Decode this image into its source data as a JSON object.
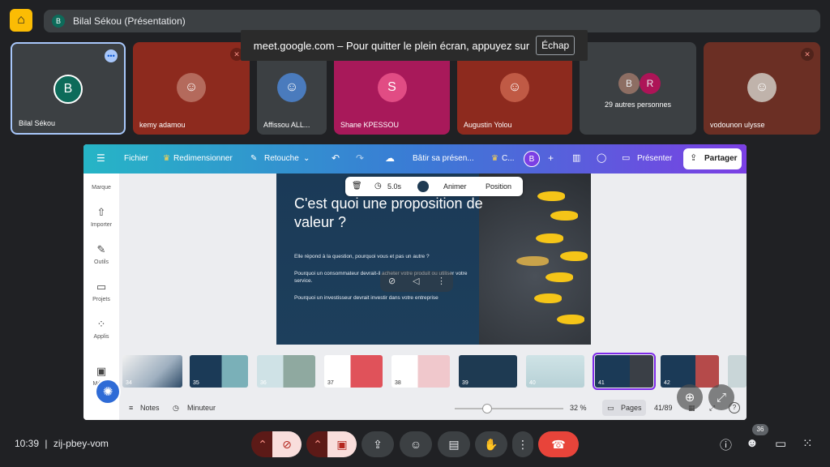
{
  "top_bar": {
    "presenter_initial": "B",
    "presenter_title": "Bilal Sékou (Présentation)"
  },
  "toast": {
    "message": "meet.google.com – Pour quitter le plein écran, appuyez sur",
    "key": "Échap"
  },
  "participants": [
    {
      "name": "Bilal Sékou",
      "initial": "B",
      "muted": false,
      "speaking": true
    },
    {
      "name": "kemy adamou",
      "initial": "",
      "muted": true
    },
    {
      "name": "Affissou ALL...",
      "initial": "",
      "muted": false
    },
    {
      "name": "Shane KPESSOU",
      "initial": "S",
      "muted": false
    },
    {
      "name": "Augustin Yolou",
      "initial": "",
      "muted": false
    },
    {
      "name": "29 autres personnes",
      "initials": [
        "B",
        "R"
      ]
    },
    {
      "name": "vodounon ulysse",
      "initial": "",
      "muted": true
    }
  ],
  "canva": {
    "menu": {
      "file": "Fichier",
      "resize": "Redimensionner",
      "edit": "Retouche",
      "doc_title": "Bâtir sa présen...",
      "crown_item": "C...",
      "user_initial": "B",
      "present": "Présenter",
      "share": "Partager"
    },
    "sidebar": [
      {
        "label": "Marque",
        "icon": "brand-icon"
      },
      {
        "label": "Importer",
        "icon": "upload-icon"
      },
      {
        "label": "Outils",
        "icon": "pen-icon"
      },
      {
        "label": "Projets",
        "icon": "folder-icon"
      },
      {
        "label": "Applis",
        "icon": "apps-icon"
      },
      {
        "label": "Médi...",
        "icon": "media-icon"
      }
    ],
    "float_toolbar": {
      "duration": "5.0s",
      "animate": "Animer",
      "position": "Position"
    },
    "slide": {
      "title": "C'est quoi une proposition de valeur ?",
      "p1": "Elle répond à la question, pourquoi vous et pas un autre ?",
      "p2": "Pourquoi un consommateur devrait-il acheter votre produit ou utiliser votre service.",
      "p3": "Pourquoi un investisseur devrait investir dans votre entreprise"
    },
    "thumbnails": [
      "34",
      "35",
      "36",
      "37",
      "38",
      "39",
      "40",
      "41",
      "42"
    ],
    "selected_thumbnail": "41",
    "bottom": {
      "notes": "Notes",
      "timer": "Minuteur",
      "zoom": "32 %",
      "zoom_fraction": 0.32,
      "pages": "Pages",
      "page_count": "41/89",
      "help": "?"
    }
  },
  "meet_bar": {
    "time": "10:39",
    "code": "zij-pbey-vom",
    "participants_count": "36"
  },
  "colors": {
    "meet_bg": "#202124",
    "canva_gradient_start": "#26b5c6",
    "canva_gradient_end": "#7b3fe4",
    "hangup": "#e8443a",
    "slide_bg": "#1b3a57",
    "fish": "#f5c518"
  }
}
